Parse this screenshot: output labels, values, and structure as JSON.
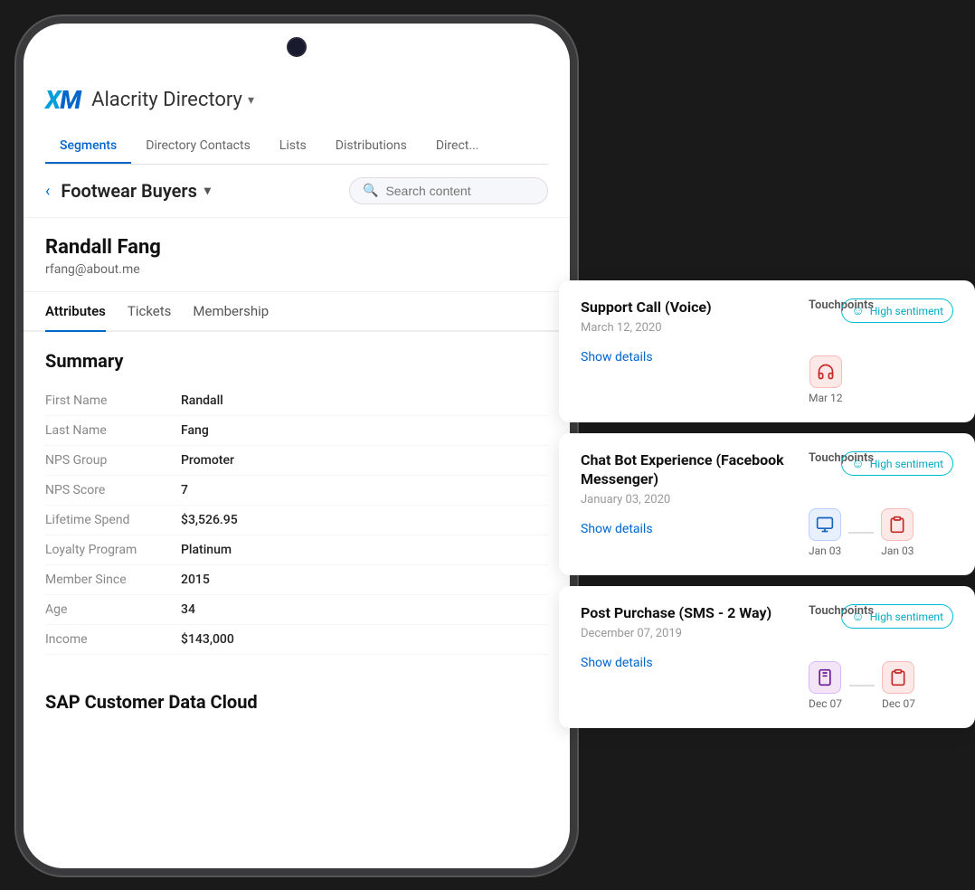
{
  "app": {
    "logo": "XM",
    "title": "Alacrity Directory",
    "title_arrow": "▾"
  },
  "nav_tabs": [
    {
      "id": "segments",
      "label": "Segments",
      "active": true
    },
    {
      "id": "directory-contacts",
      "label": "Directory Contacts",
      "active": false
    },
    {
      "id": "lists",
      "label": "Lists",
      "active": false
    },
    {
      "id": "distributions",
      "label": "Distributions",
      "active": false
    },
    {
      "id": "direct",
      "label": "Direct...",
      "active": false
    }
  ],
  "segment_bar": {
    "back_label": "‹",
    "segment_name": "Footwear Buyers",
    "dropdown_arrow": "▾",
    "search_placeholder": "Search content"
  },
  "contact": {
    "name": "Randall Fang",
    "email": "rfang@about.me"
  },
  "sub_tabs": [
    {
      "id": "attributes",
      "label": "Attributes",
      "active": true
    },
    {
      "id": "tickets",
      "label": "Tickets",
      "active": false
    },
    {
      "id": "membership",
      "label": "Membership",
      "active": false
    }
  ],
  "summary": {
    "title": "Summary",
    "attributes": [
      {
        "label": "First Name",
        "value": "Randall"
      },
      {
        "label": "Last Name",
        "value": "Fang"
      },
      {
        "label": "NPS Group",
        "value": "Promoter"
      },
      {
        "label": "NPS Score",
        "value": "7"
      },
      {
        "label": "Lifetime Spend",
        "value": "$3,526.95"
      },
      {
        "label": "Loyalty Program",
        "value": "Platinum"
      },
      {
        "label": "Member Since",
        "value": "2015"
      },
      {
        "label": "Age",
        "value": "34"
      },
      {
        "label": "Income",
        "value": "$143,000"
      }
    ]
  },
  "sap_section": {
    "title": "SAP Customer Data Cloud"
  },
  "journey_cards": [
    {
      "id": "support-call",
      "title": "Support Call (Voice)",
      "date": "March 12, 2020",
      "show_details": "Show details",
      "touchpoints_label": "Touchpoints",
      "sentiment_label": "High sentiment",
      "touchpoints": [
        {
          "icon": "headset",
          "date": "Mar 12",
          "emoji": "🎧"
        }
      ]
    },
    {
      "id": "chatbot",
      "title": "Chat Bot Experience (Facebook Messenger)",
      "date": "January 03, 2020",
      "show_details": "Show details",
      "touchpoints_label": "Touchpoints",
      "sentiment_label": "High sentiment",
      "touchpoints": [
        {
          "icon": "browser",
          "date": "Jan 03",
          "emoji": "🖥"
        },
        {
          "icon": "clipboard",
          "date": "Jan 03",
          "emoji": "📋"
        }
      ]
    },
    {
      "id": "post-purchase",
      "title": "Post Purchase (SMS - 2 Way)",
      "date": "December 07, 2019",
      "show_details": "Show details",
      "touchpoints_label": "Touchpoints",
      "sentiment_label": "High sentiment",
      "touchpoints": [
        {
          "icon": "sms",
          "date": "Dec 07",
          "emoji": "📲"
        },
        {
          "icon": "clipboard",
          "date": "Dec 07",
          "emoji": "📋"
        }
      ]
    }
  ],
  "icons": {
    "smiley": "☺",
    "search": "🔍"
  }
}
